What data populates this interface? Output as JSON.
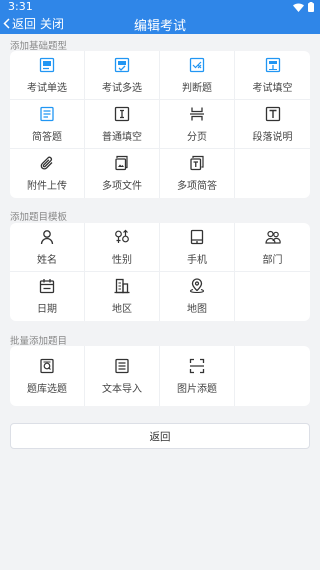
{
  "status_bar": {
    "time": "3:31"
  },
  "header": {
    "back_label": "返回",
    "close_label": "关闭",
    "title": "编辑考试"
  },
  "sections": {
    "basic": {
      "title": "添加基础题型",
      "items": [
        {
          "label": "考试单选",
          "icon": "exam-single-choice-icon"
        },
        {
          "label": "考试多选",
          "icon": "exam-multiple-choice-icon"
        },
        {
          "label": "判断题",
          "icon": "true-false-icon"
        },
        {
          "label": "考试填空",
          "icon": "exam-fill-blank-icon"
        },
        {
          "label": "简答题",
          "icon": "short-answer-icon"
        },
        {
          "label": "普通填空",
          "icon": "fill-blank-icon"
        },
        {
          "label": "分页",
          "icon": "page-break-icon"
        },
        {
          "label": "段落说明",
          "icon": "paragraph-icon"
        },
        {
          "label": "附件上传",
          "icon": "attachment-icon"
        },
        {
          "label": "多项文件",
          "icon": "multi-file-icon"
        },
        {
          "label": "多项简答",
          "icon": "multi-short-answer-icon"
        }
      ]
    },
    "template": {
      "title": "添加题目模板",
      "items": [
        {
          "label": "姓名",
          "icon": "person-icon"
        },
        {
          "label": "性别",
          "icon": "gender-icon"
        },
        {
          "label": "手机",
          "icon": "phone-icon"
        },
        {
          "label": "部门",
          "icon": "department-icon"
        },
        {
          "label": "日期",
          "icon": "calendar-icon"
        },
        {
          "label": "地区",
          "icon": "building-icon"
        },
        {
          "label": "地图",
          "icon": "map-pin-icon"
        }
      ]
    },
    "batch": {
      "title": "批量添加题目",
      "items": [
        {
          "label": "题库选题",
          "icon": "question-bank-icon"
        },
        {
          "label": "文本导入",
          "icon": "text-import-icon"
        },
        {
          "label": "图片添题",
          "icon": "image-scan-icon"
        }
      ]
    }
  },
  "footer": {
    "return_label": "返回"
  },
  "colors": {
    "primary": "#2f86e8",
    "icon_blue": "#2196f3",
    "icon_dark": "#333333",
    "background": "#f2f3f5"
  }
}
